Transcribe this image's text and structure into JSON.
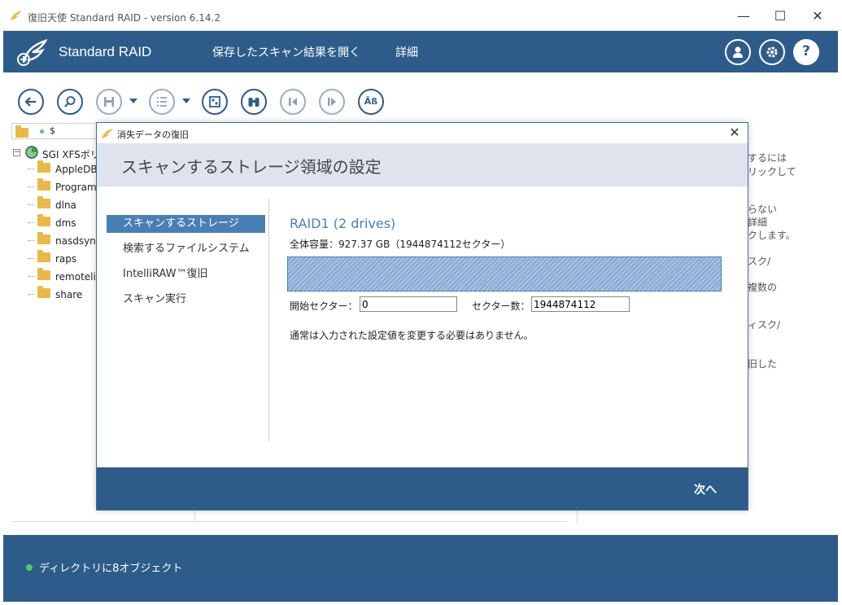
{
  "window": {
    "title": "復旧天使 Standard RAID - version 6.14.2",
    "minimize": "—",
    "maximize": "☐",
    "close": "✕"
  },
  "header": {
    "product": "Standard RAID",
    "nav": [
      "保存したスキャン結果を開く",
      "詳細"
    ],
    "icons": [
      "user-icon",
      "gear-icon",
      "help-icon"
    ],
    "help_label": "?"
  },
  "toolbar": {
    "buttons": [
      "back-icon",
      "search-icon",
      "save-icon",
      "list-icon",
      "preview-icon",
      "binoculars-icon",
      "prev-icon",
      "next-icon",
      "ab-icon"
    ],
    "ab_label": "Äß"
  },
  "left_panel": {
    "path": "$",
    "root": "SGI XFSボリ",
    "folders": [
      "AppleDB",
      "Program",
      "dlna",
      "dms",
      "nasdsyn",
      "raps",
      "remoteli",
      "share"
    ]
  },
  "hint_lines": [
    "するには",
    "リックして",
    "らない",
    "詳細",
    "クします。",
    "スク/",
    "複数の",
    "ィスク/",
    "旧した"
  ],
  "status": {
    "text": "ディレクトリに8オブジェクト"
  },
  "dialog": {
    "title": "消失データの復旧",
    "close": "✕",
    "heading": "スキャンするストレージ領域の設定",
    "steps": [
      "スキャンするストレージ",
      "検索するファイルシステム",
      "IntelliRAW™復旧",
      "スキャン実行"
    ],
    "active_step": 0,
    "raid_title": "RAID1 (2 drives)",
    "capacity": "全体容量：927.37 GB（1944874112セクター）",
    "start_sector_label": "開始セクター：",
    "start_sector_value": "0",
    "sector_count_label": "セクター数：",
    "sector_count_value": "1944874112",
    "note": "通常は入力された設定値を変更する必要はありません。",
    "next_button": "次へ"
  },
  "colors": {
    "brand": "#2e5c8a",
    "accent": "#4a7fb5",
    "status_dot": "#4ccd6a",
    "folder": "#e8b94a"
  }
}
